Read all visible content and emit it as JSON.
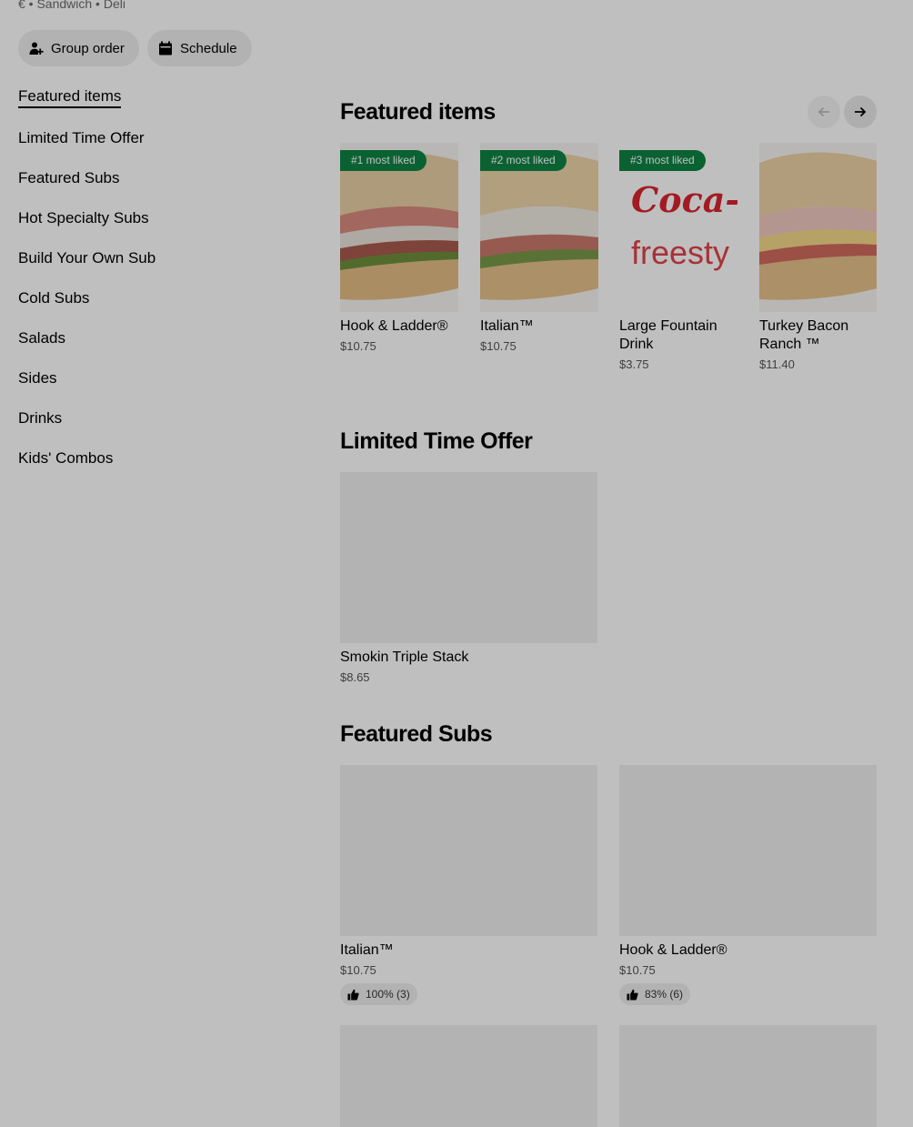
{
  "store": {
    "meta": "€ • Sandwich • Deli"
  },
  "actions": {
    "group_order": "Group order",
    "schedule": "Schedule"
  },
  "sidebar": {
    "items": [
      {
        "label": "Featured items",
        "active": true
      },
      {
        "label": "Limited Time Offer"
      },
      {
        "label": "Featured Subs"
      },
      {
        "label": "Hot Specialty Subs"
      },
      {
        "label": "Build Your Own Sub"
      },
      {
        "label": "Cold Subs"
      },
      {
        "label": "Salads"
      },
      {
        "label": "Sides"
      },
      {
        "label": "Drinks"
      },
      {
        "label": "Kids' Combos"
      }
    ]
  },
  "featured": {
    "title": "Featured items",
    "items": [
      {
        "badge": "#1 most liked",
        "name": "Hook & Ladder®",
        "price": "$10.75"
      },
      {
        "badge": "#2 most liked",
        "name": "Italian™",
        "price": "$10.75"
      },
      {
        "badge": "#3 most liked",
        "name": "Large Fountain Drink",
        "price": "$3.75",
        "image_text": [
          "Coca-Co",
          "freesty"
        ]
      },
      {
        "name": "Turkey Bacon Ranch ™",
        "price": "$11.40"
      }
    ]
  },
  "limited": {
    "title": "Limited Time Offer",
    "items": [
      {
        "name": "Smokin Triple Stack",
        "price": "$8.65"
      }
    ]
  },
  "featured_subs": {
    "title": "Featured Subs",
    "items": [
      {
        "name": "Italian™",
        "price": "$10.75",
        "rating": "100% (3)"
      },
      {
        "name": "Hook & Ladder®",
        "price": "$10.75",
        "rating": "83% (6)"
      }
    ]
  },
  "colors": {
    "badge_green": "#0e8345",
    "overlay": "rgba(0,0,0,0.25)"
  }
}
